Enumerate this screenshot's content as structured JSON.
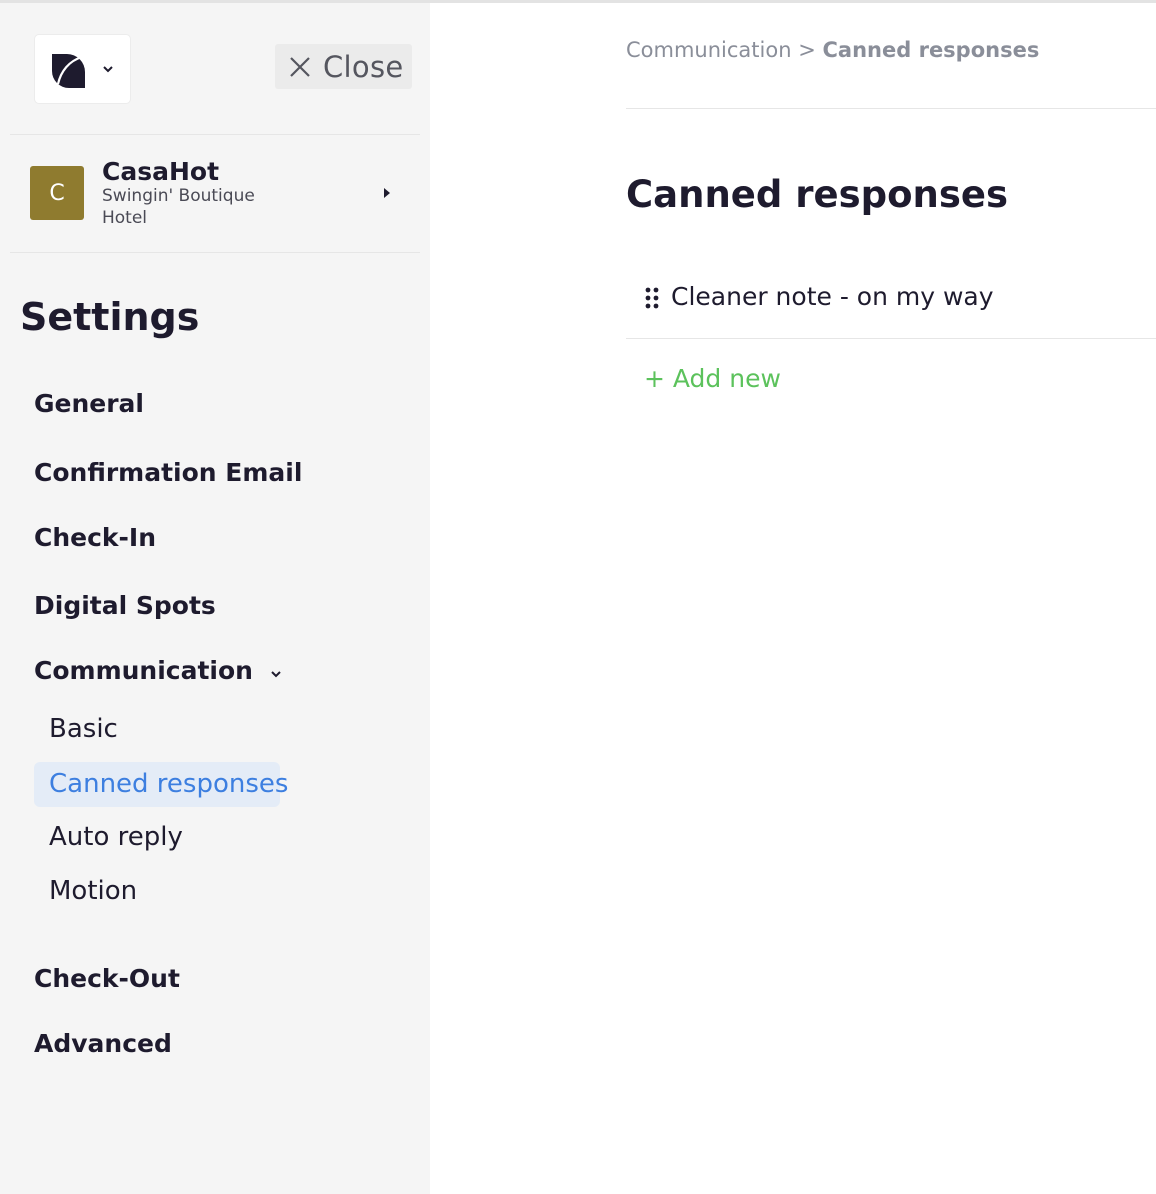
{
  "sidebar": {
    "close_label": "Close",
    "property": {
      "initial": "C",
      "name": "CasaHot",
      "subtitle": "Swingin' Boutique Hotel",
      "avatar_color": "#8f7b2f"
    },
    "settings_title": "Settings",
    "nav": [
      {
        "label": "General"
      },
      {
        "label": "Confirmation Email"
      },
      {
        "label": "Check-In"
      },
      {
        "label": "Digital Spots"
      },
      {
        "label": "Communication",
        "expanded": true
      },
      {
        "label": "Check-Out"
      },
      {
        "label": "Advanced"
      }
    ],
    "communication_sub": [
      {
        "label": "Basic"
      },
      {
        "label": "Canned responses",
        "active": true
      },
      {
        "label": "Auto reply"
      },
      {
        "label": "Motion"
      }
    ]
  },
  "main": {
    "breadcrumb": {
      "parent": "Communication",
      "separator": ">",
      "current": "Canned responses"
    },
    "title": "Canned responses",
    "responses": [
      {
        "text": "Cleaner note - on my way"
      }
    ],
    "add_new_label": "+ Add new"
  },
  "colors": {
    "accent_blue": "#3d7fe0",
    "active_bg": "#e4ecf7",
    "add_green": "#5cc25c",
    "sidebar_bg": "#f5f5f5"
  },
  "icons": {
    "logo": "brand-logo-icon",
    "logo_menu": "chevron-down-icon",
    "close": "close-icon",
    "property_arrow": "caret-right-icon",
    "communication_toggle": "chevron-down-icon",
    "drag": "drag-handle-icon"
  }
}
